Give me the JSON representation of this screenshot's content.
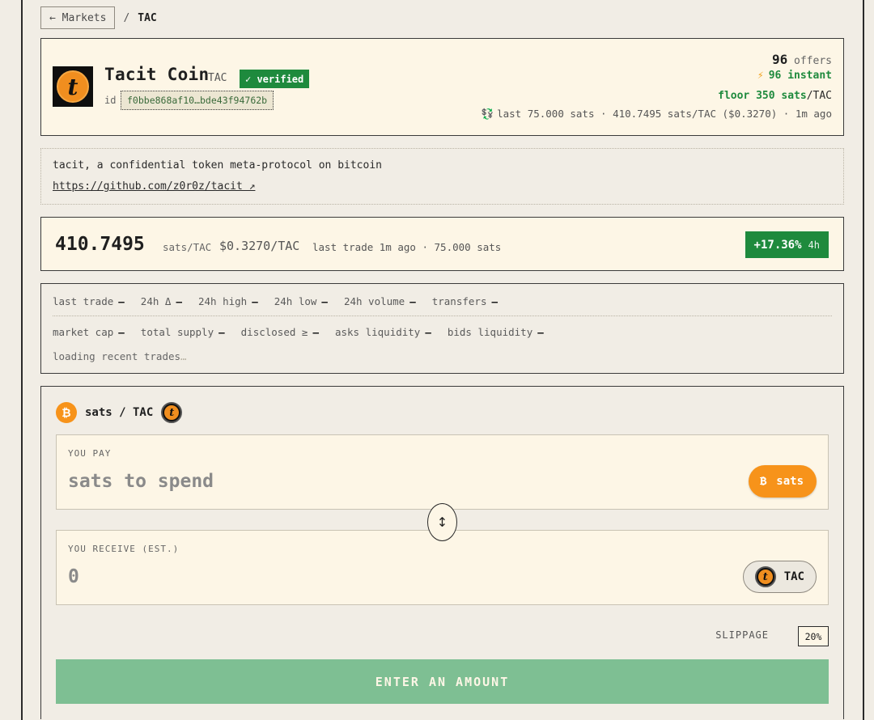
{
  "breadcrumb": {
    "back_label": "← Markets",
    "separator": "/",
    "current": "TAC"
  },
  "token": {
    "name": "Tacit Coin",
    "ticker": "TAC",
    "verified_label": "✓ verified",
    "id_label": "id",
    "id_value": "f0bbe868af10…bde43f94762b",
    "logo_glyph": "t"
  },
  "header_stats": {
    "offers_count": "96",
    "offers_label": "offers",
    "instant_icon": "⚡",
    "instant_label": "96 instant",
    "floor_label": "floor 350 sats",
    "floor_unit": "/TAC",
    "last_icon": "💱",
    "last_trade_line": "last 75.000 sats · 410.7495 sats/TAC ($0.3270) · 1m ago"
  },
  "description": {
    "text": "tacit, a confidential token meta-protocol on bitcoin",
    "link": "https://github.com/z0r0z/tacit ↗"
  },
  "price": {
    "value": "410.7495",
    "unit": "sats/TAC",
    "usd": "$0.3270/TAC",
    "last_trade": "last trade 1m ago · 75.000 sats",
    "change": "+17.36%",
    "change_period": "4h"
  },
  "stats": {
    "row1": [
      {
        "key": "last trade",
        "value": "–"
      },
      {
        "key": "24h Δ",
        "value": "–"
      },
      {
        "key": "24h high",
        "value": "–"
      },
      {
        "key": "24h low",
        "value": "–"
      },
      {
        "key": "24h volume",
        "value": "–"
      },
      {
        "key": "transfers",
        "value": "–"
      }
    ],
    "row2": [
      {
        "key": "market cap",
        "value": "–"
      },
      {
        "key": "total supply",
        "value": "–"
      },
      {
        "key": "disclosed ≥",
        "value": "–"
      },
      {
        "key": "asks liquidity",
        "value": "–"
      },
      {
        "key": "bids liquidity",
        "value": "–"
      }
    ],
    "loading": "loading recent trades",
    "loading_dots": "…"
  },
  "swap": {
    "pair_label": "sats / TAC",
    "btc_glyph": "₿",
    "pay_label": "YOU PAY",
    "pay_placeholder": "sats to spend",
    "pay_token": "sats",
    "flip_icon": "↕",
    "receive_label": "YOU RECEIVE (EST.)",
    "receive_value": "0",
    "receive_token": "TAC",
    "slippage_label": "SLIPPAGE",
    "slippage_value": "20%",
    "cta_label": "ENTER AN AMOUNT"
  },
  "colors": {
    "accent_green": "#1e8a3d",
    "bitcoin_orange": "#f7931a",
    "cta_disabled": "#7ebf93",
    "card_bg": "#fdf6e6",
    "page_bg": "#f1ede5"
  }
}
